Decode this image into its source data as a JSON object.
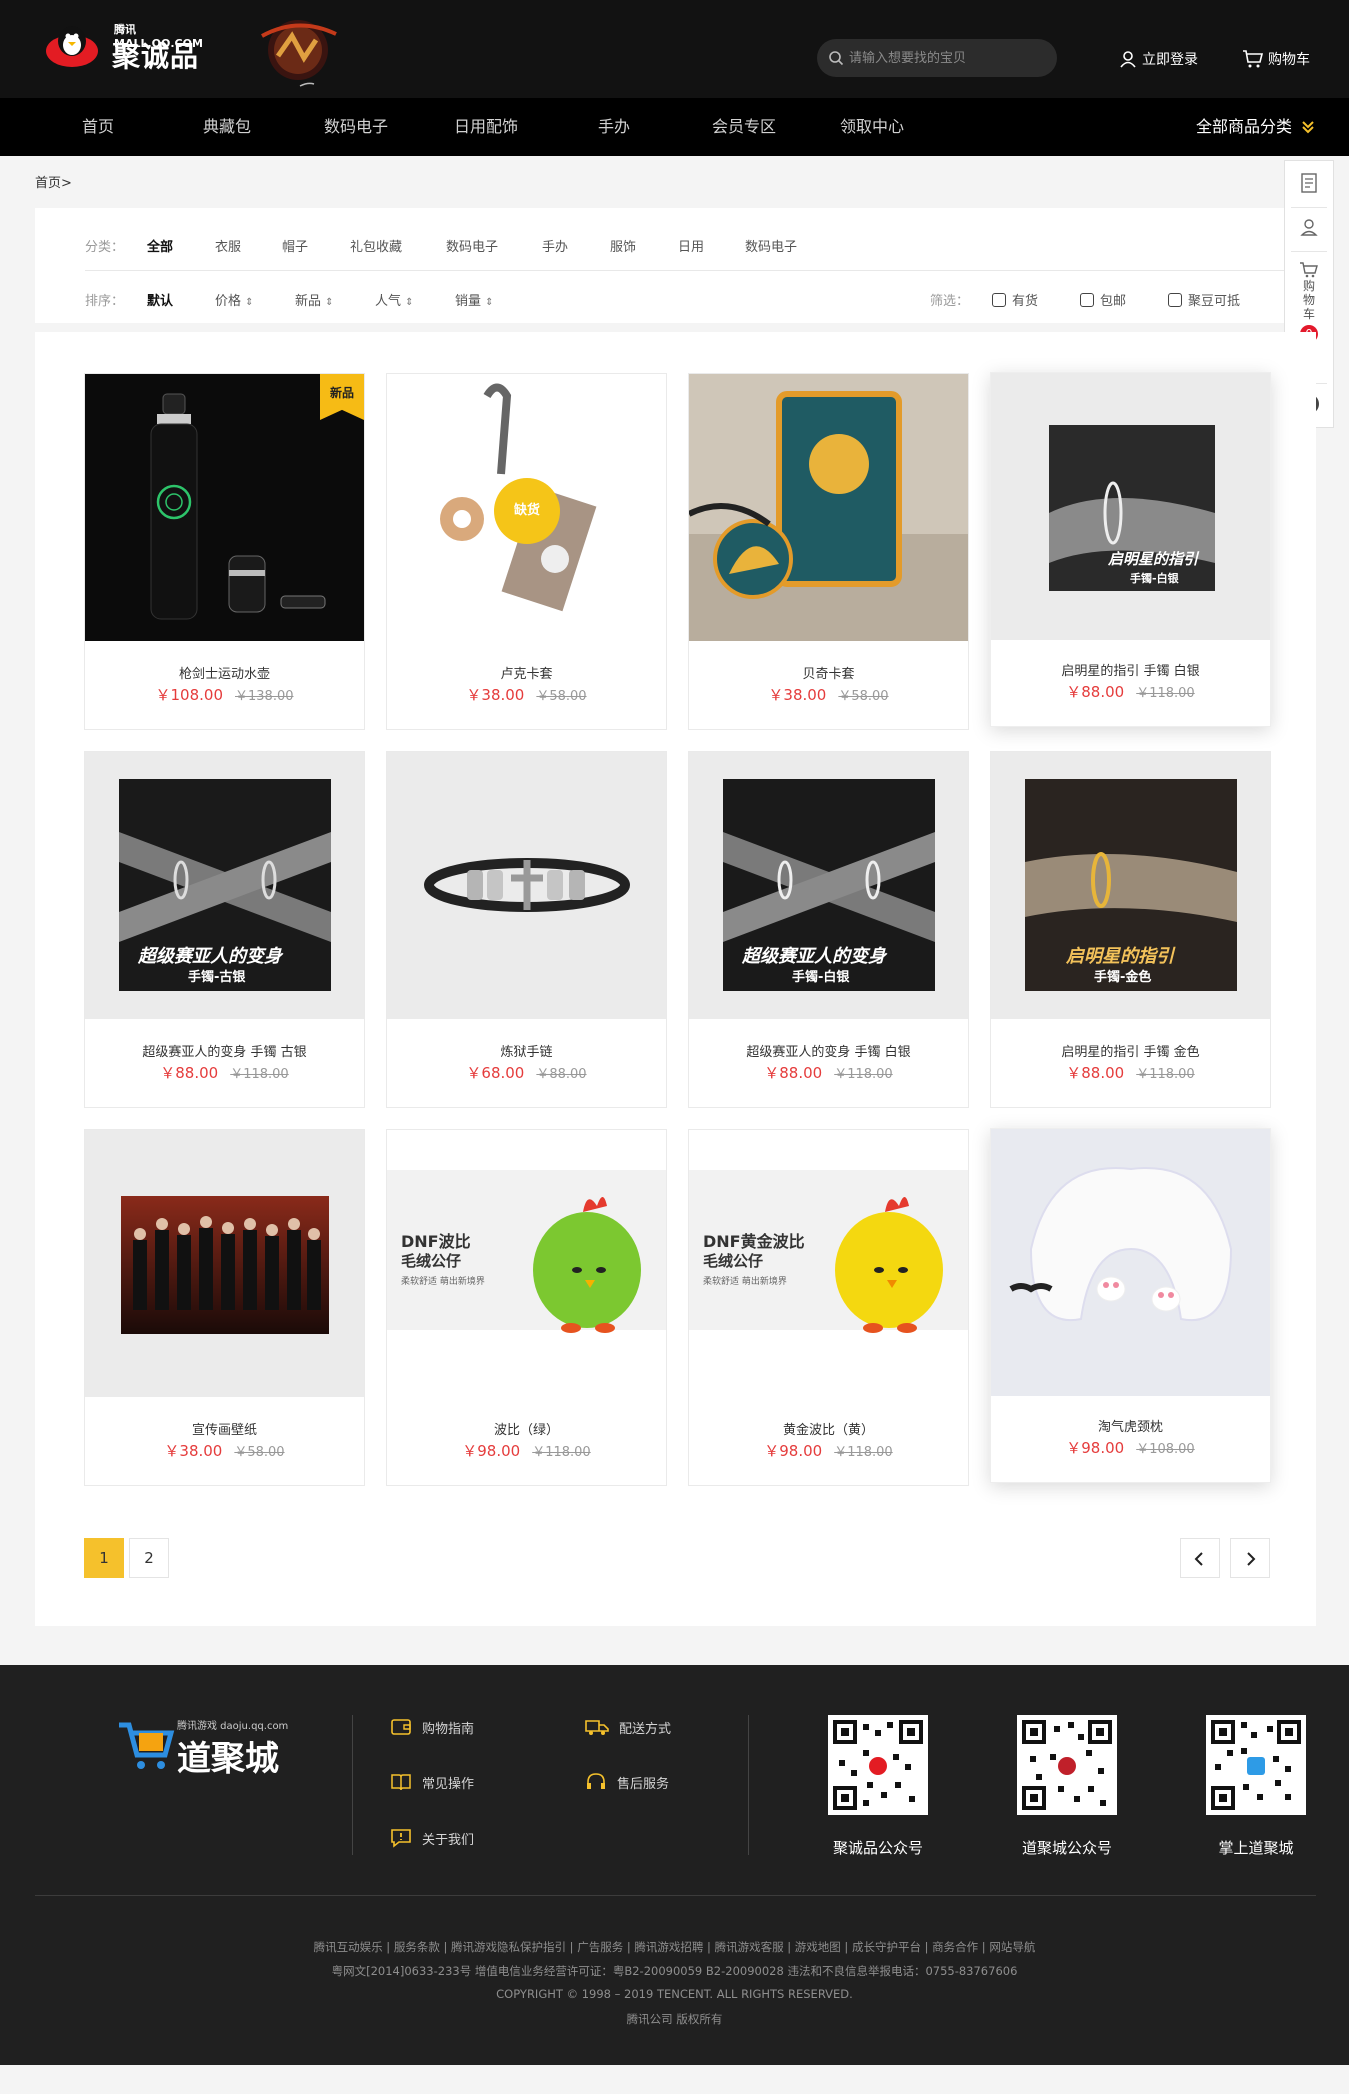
{
  "header": {
    "logo_small": "腾讯 MALL.QQ.COM",
    "logo_big": "聚诚品",
    "search_placeholder": "请输入想要找的宝贝",
    "login": "立即登录",
    "cart": "购物车"
  },
  "nav": {
    "items": [
      "首页",
      "典藏包",
      "数码电子",
      "日用配饰",
      "手办",
      "会员专区",
      "领取中心"
    ],
    "all_categories": "全部商品分类"
  },
  "breadcrumb": "首页>",
  "filter": {
    "category_label": "分类：",
    "categories": [
      "全部",
      "衣服",
      "帽子",
      "礼包收藏",
      "数码电子",
      "手办",
      "服饰",
      "日用",
      "数码电子"
    ],
    "sort_label": "排序：",
    "sorts": [
      "默认",
      "价格",
      "新品",
      "人气",
      "销量"
    ],
    "screen_label": "筛选：",
    "checks": [
      "有货",
      "包邮",
      "聚豆可抵"
    ]
  },
  "sidebar": {
    "cart_label": "购物车",
    "cart_count": "0"
  },
  "products": [
    {
      "name": "枪剑士运动水壶",
      "price": "￥108.00",
      "old": "￥138.00",
      "tag": "新品"
    },
    {
      "name": "卢克卡套",
      "price": "￥38.00",
      "old": "￥58.00",
      "stock": "缺货"
    },
    {
      "name": "贝奇卡套",
      "price": "￥38.00",
      "old": "￥58.00"
    },
    {
      "name": "启明星的指引 手镯 白银",
      "price": "￥88.00",
      "old": "￥118.00",
      "caption": [
        "启明星的指引",
        "手镯-白银"
      ]
    },
    {
      "name": "超级赛亚人的变身 手镯 古银",
      "price": "￥88.00",
      "old": "￥118.00",
      "caption": [
        "超级赛亚人的变身",
        "手镯-古银"
      ]
    },
    {
      "name": "炼狱手链",
      "price": "￥68.00",
      "old": "￥88.00"
    },
    {
      "name": "超级赛亚人的变身 手镯 白银",
      "price": "￥88.00",
      "old": "￥118.00",
      "caption": [
        "超级赛亚人的变身",
        "手镯-白银"
      ]
    },
    {
      "name": "启明星的指引 手镯 金色",
      "price": "￥88.00",
      "old": "￥118.00",
      "caption": [
        "启明星的指引",
        "手镯-金色"
      ]
    },
    {
      "name": "宣传画壁纸",
      "price": "￥38.00",
      "old": "￥58.00"
    },
    {
      "name": "波比（绿）",
      "price": "￥98.00",
      "old": "￥118.00",
      "caption": [
        "DNF波比",
        "毛绒公仔",
        "柔软舒适  萌出新境界"
      ]
    },
    {
      "name": "黄金波比（黄）",
      "price": "￥98.00",
      "old": "￥118.00",
      "caption": [
        "DNF黄金波比",
        "毛绒公仔",
        "柔软舒适  萌出新境界"
      ]
    },
    {
      "name": "淘气虎颈枕",
      "price": "￥98.00",
      "old": "￥108.00"
    }
  ],
  "pagination": {
    "pages": [
      "1",
      "2"
    ],
    "current": "1"
  },
  "footer": {
    "brand_small": "腾讯游戏 daoju.qq.com",
    "brand_big": "道聚城",
    "links": [
      "购物指南",
      "配送方式",
      "常见操作",
      "售后服务",
      "关于我们"
    ],
    "qrcodes": [
      "聚诚品公众号",
      "道聚城公众号",
      "掌上道聚城"
    ],
    "copy": [
      "腾讯互动娱乐 | 服务条款 | 腾讯游戏隐私保护指引 | 广告服务 | 腾讯游戏招聘 | 腾讯游戏客服 | 游戏地图 | 成长守护平台 | 商务合作 | 网站导航",
      "粤网文[2014]0633-233号 增值电信业务经营许可证：粤B2-20090059 B2-20090028 违法和不良信息举报电话：0755-83767606",
      "COPYRIGHT © 1998 – 2019 TENCENT. ALL RIGHTS RESERVED.",
      "腾讯公司 版权所有"
    ]
  },
  "colors": {
    "accent": "#f5c12c",
    "price": "#e53c3c",
    "header": "#121212",
    "footer": "#202020"
  }
}
